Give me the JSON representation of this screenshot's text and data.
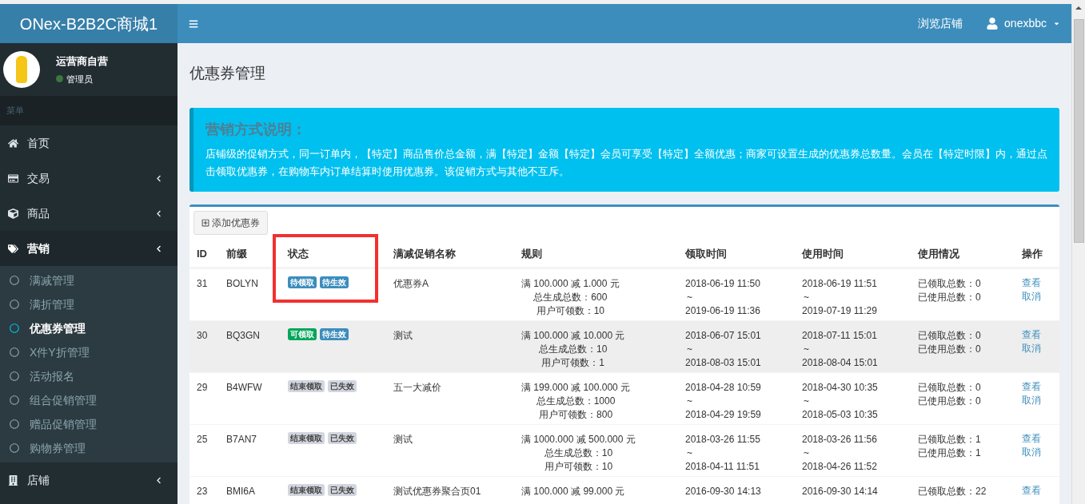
{
  "brand": "ONex-B2B2C商城1",
  "header": {
    "browse_link": "浏览店铺",
    "user": "onexbbc"
  },
  "profile": {
    "name": "运营商自营",
    "role": "管理员",
    "online": true
  },
  "menu_label": "菜单",
  "sidebar": {
    "items": [
      {
        "label": "首页",
        "expandable": false,
        "expanded": false
      },
      {
        "label": "交易",
        "expandable": true,
        "expanded": false
      },
      {
        "label": "商品",
        "expandable": true,
        "expanded": false
      },
      {
        "label": "营销",
        "expandable": true,
        "expanded": true,
        "children": [
          {
            "label": "满减管理",
            "selected": false
          },
          {
            "label": "满折管理",
            "selected": false
          },
          {
            "label": "优惠券管理",
            "selected": true
          },
          {
            "label": "X件Y折管理",
            "selected": false
          },
          {
            "label": "活动报名",
            "selected": false
          },
          {
            "label": "组合促销管理",
            "selected": false
          },
          {
            "label": "赠品促销管理",
            "selected": false
          },
          {
            "label": "购物券管理",
            "selected": false
          }
        ]
      },
      {
        "label": "店铺",
        "expandable": true,
        "expanded": false
      }
    ]
  },
  "page_title": "优惠券管理",
  "callout": {
    "title": "营销方式说明：",
    "text": "店铺级的促销方式，同一订单内，【特定】商品售价总金额，满【特定】金额【特定】会员可享受【特定】全额优惠；商家可设置生成的优惠券总数量。会员在【特定时限】内，通过点击领取优惠券，在购物车内订单结算时使用优惠券。该促销方式与其他不互斥。"
  },
  "add_button": "添加优惠券",
  "table": {
    "columns": [
      "ID",
      "前缀",
      "状态",
      "满减促销名称",
      "规则",
      "领取时间",
      "使用时间",
      "使用情况",
      "操作"
    ],
    "rows": [
      {
        "id": "31",
        "prefix": "BOLYN",
        "badges": [
          {
            "label": "待领取",
            "kind": "primary"
          },
          {
            "label": "待生效",
            "kind": "primary"
          }
        ],
        "name": "优惠券A",
        "rule": [
          "满 100.000 减 1.000 元",
          "总生成总数：600",
          "用户可领数：10"
        ],
        "receive": [
          "2018-06-19 11:50",
          "~",
          "2019-06-19 11:36"
        ],
        "use": [
          "2018-06-19 11:51",
          "~",
          "2019-07-19 11:29"
        ],
        "usage": [
          "已领取总数：0",
          "已使用总数：0"
        ],
        "actions": [
          "查看",
          "取消"
        ],
        "selected": false
      },
      {
        "id": "30",
        "prefix": "BQ3GN",
        "badges": [
          {
            "label": "可领取",
            "kind": "success"
          },
          {
            "label": "待生效",
            "kind": "primary"
          }
        ],
        "name": "测试",
        "rule": [
          "满 100.000 减 10.000 元",
          "总生成总数：10",
          "用户可领数：1"
        ],
        "receive": [
          "2018-06-07 15:01",
          "~",
          "2018-08-03 15:01"
        ],
        "use": [
          "2018-07-11 15:01",
          "~",
          "2018-08-04 15:01"
        ],
        "usage": [
          "已领取总数：0",
          "已使用总数：0"
        ],
        "actions": [
          "查看",
          "取消"
        ],
        "selected": true
      },
      {
        "id": "29",
        "prefix": "B4WFW",
        "badges": [
          {
            "label": "结束领取",
            "kind": "default"
          },
          {
            "label": "已失效",
            "kind": "default"
          }
        ],
        "name": "五一大减价",
        "rule": [
          "满 199.000 减 100.000 元",
          "总生成总数：1000",
          "用户可领数：800"
        ],
        "receive": [
          "2018-04-28 10:59",
          "~",
          "2018-04-29 19:59"
        ],
        "use": [
          "2018-04-30 10:35",
          "~",
          "2018-05-03 10:35"
        ],
        "usage": [
          "已领取总数：0",
          "已使用总数：0"
        ],
        "actions": [
          "查看",
          "取消"
        ],
        "selected": false
      },
      {
        "id": "25",
        "prefix": "B7AN7",
        "badges": [
          {
            "label": "结束领取",
            "kind": "default"
          },
          {
            "label": "已失效",
            "kind": "default"
          }
        ],
        "name": "测试",
        "rule": [
          "满 1000.000 减 500.000 元",
          "总生成总数：10",
          "用户可领数：10"
        ],
        "receive": [
          "2018-03-26 11:55",
          "~",
          "2018-04-11 11:51"
        ],
        "use": [
          "2018-03-26 11:56",
          "~",
          "2018-04-26 11:52"
        ],
        "usage": [
          "已领取总数：1",
          "已使用总数：1"
        ],
        "actions": [
          "查看",
          "取消"
        ],
        "selected": false
      },
      {
        "id": "23",
        "prefix": "BMI6A",
        "badges": [
          {
            "label": "结束领取",
            "kind": "default"
          },
          {
            "label": "已失效",
            "kind": "default"
          }
        ],
        "name": "测试优惠券聚合页01",
        "rule": [
          "满 100.000 减 99.000 元"
        ],
        "receive": [
          "2016-09-30 14:13"
        ],
        "use": [
          "2016-09-30 14:14"
        ],
        "usage": [
          "已领取总数：22"
        ],
        "actions": [
          "查看"
        ],
        "selected": false
      }
    ]
  }
}
